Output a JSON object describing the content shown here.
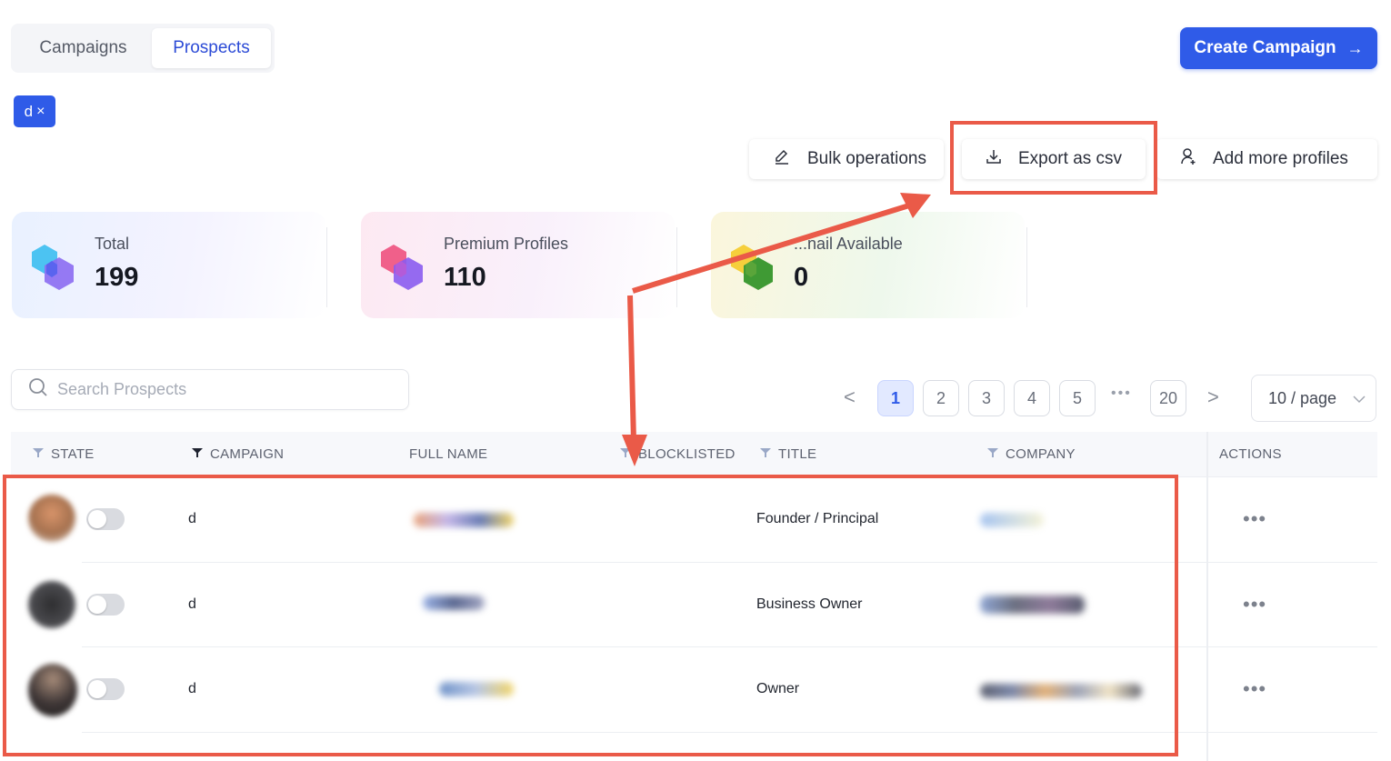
{
  "tabs": {
    "campaigns": "Campaigns",
    "prospects": "Prospects"
  },
  "create_button": {
    "label": "Create Campaign",
    "icon": "arrow-right-icon"
  },
  "filter_chip": {
    "label": "d",
    "close": "×"
  },
  "actions": {
    "bulk": "Bulk operations",
    "export": "Export as csv",
    "add_more": "Add more profiles"
  },
  "stats": {
    "total": {
      "label": "Total",
      "value": "199"
    },
    "premium": {
      "label": "Premium Profiles",
      "value": "110"
    },
    "email": {
      "label": "...nail Available",
      "value": "0"
    }
  },
  "search": {
    "placeholder": "Search Prospects"
  },
  "pagination": {
    "pages": [
      "1",
      "2",
      "3",
      "4",
      "5"
    ],
    "ellipsis": "•••",
    "last": "20",
    "prev": "<",
    "next": ">",
    "page_size": "10 / page",
    "current": "1"
  },
  "table": {
    "headers": {
      "state": "STATE",
      "campaign": "CAMPAIGN",
      "full_name": "FULL NAME",
      "blocklisted": "BLOCKLISTED",
      "title": "TITLE",
      "company": "COMPANY",
      "actions": "ACTIONS"
    },
    "rows": [
      {
        "campaign": "d",
        "title": "Founder / Principal",
        "state_on": false
      },
      {
        "campaign": "d",
        "title": "Business Owner",
        "state_on": false
      },
      {
        "campaign": "d",
        "title": "Owner",
        "state_on": false
      }
    ],
    "row_action": "•••"
  },
  "colors": {
    "accent": "#2f5be8",
    "annotation": "#ea5a48"
  }
}
